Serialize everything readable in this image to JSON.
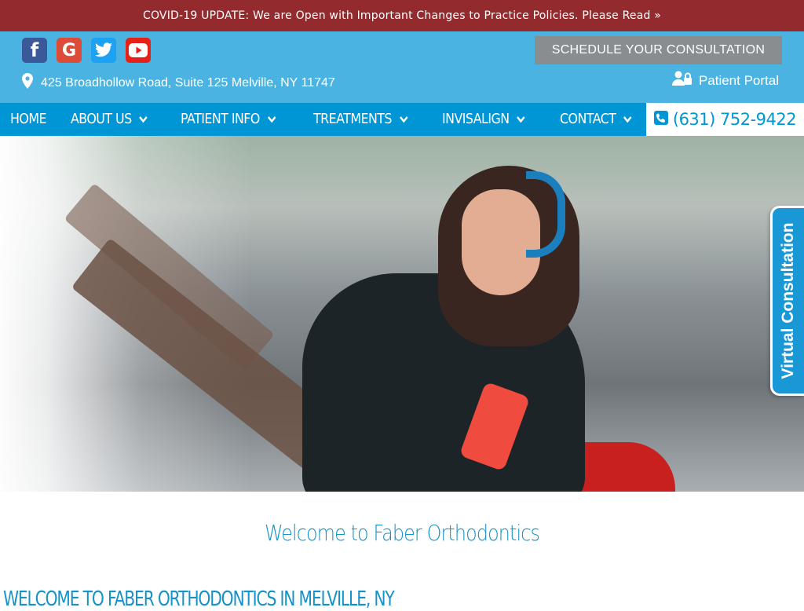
{
  "covid_banner": {
    "text": "COVID-19 UPDATE: We are Open with Important Changes to Practice Policies. Please Read »"
  },
  "header": {
    "social": [
      {
        "name": "facebook-icon",
        "glyph": "f"
      },
      {
        "name": "google-icon",
        "glyph": "G"
      },
      {
        "name": "twitter-icon"
      },
      {
        "name": "youtube-icon"
      }
    ],
    "address": "425 Broadhollow Road, Suite 125 Melville, NY 11747",
    "schedule_label": "SCHEDULE YOUR CONSULTATION",
    "portal_label": "Patient Portal"
  },
  "nav": {
    "items": [
      {
        "label": "HOME",
        "dropdown": false
      },
      {
        "label": "ABOUT US",
        "dropdown": true
      },
      {
        "label": "PATIENT INFO",
        "dropdown": true
      },
      {
        "label": "TREATMENTS",
        "dropdown": true
      },
      {
        "label": "INVISALIGN",
        "dropdown": true
      },
      {
        "label": "CONTACT",
        "dropdown": true
      }
    ],
    "phone": "(631) 752-9422"
  },
  "virtual_tab": {
    "label": "Virtual Consultation"
  },
  "main": {
    "welcome_title": "Welcome to Faber Orthodontics",
    "welcome_heading": "WELCOME TO FABER ORTHODONTICS IN MELVILLE, NY"
  },
  "colors": {
    "banner": "#932a2e",
    "top_bar": "#4ab3e1",
    "nav": "#0096d6",
    "accent_text": "#1592c8"
  }
}
